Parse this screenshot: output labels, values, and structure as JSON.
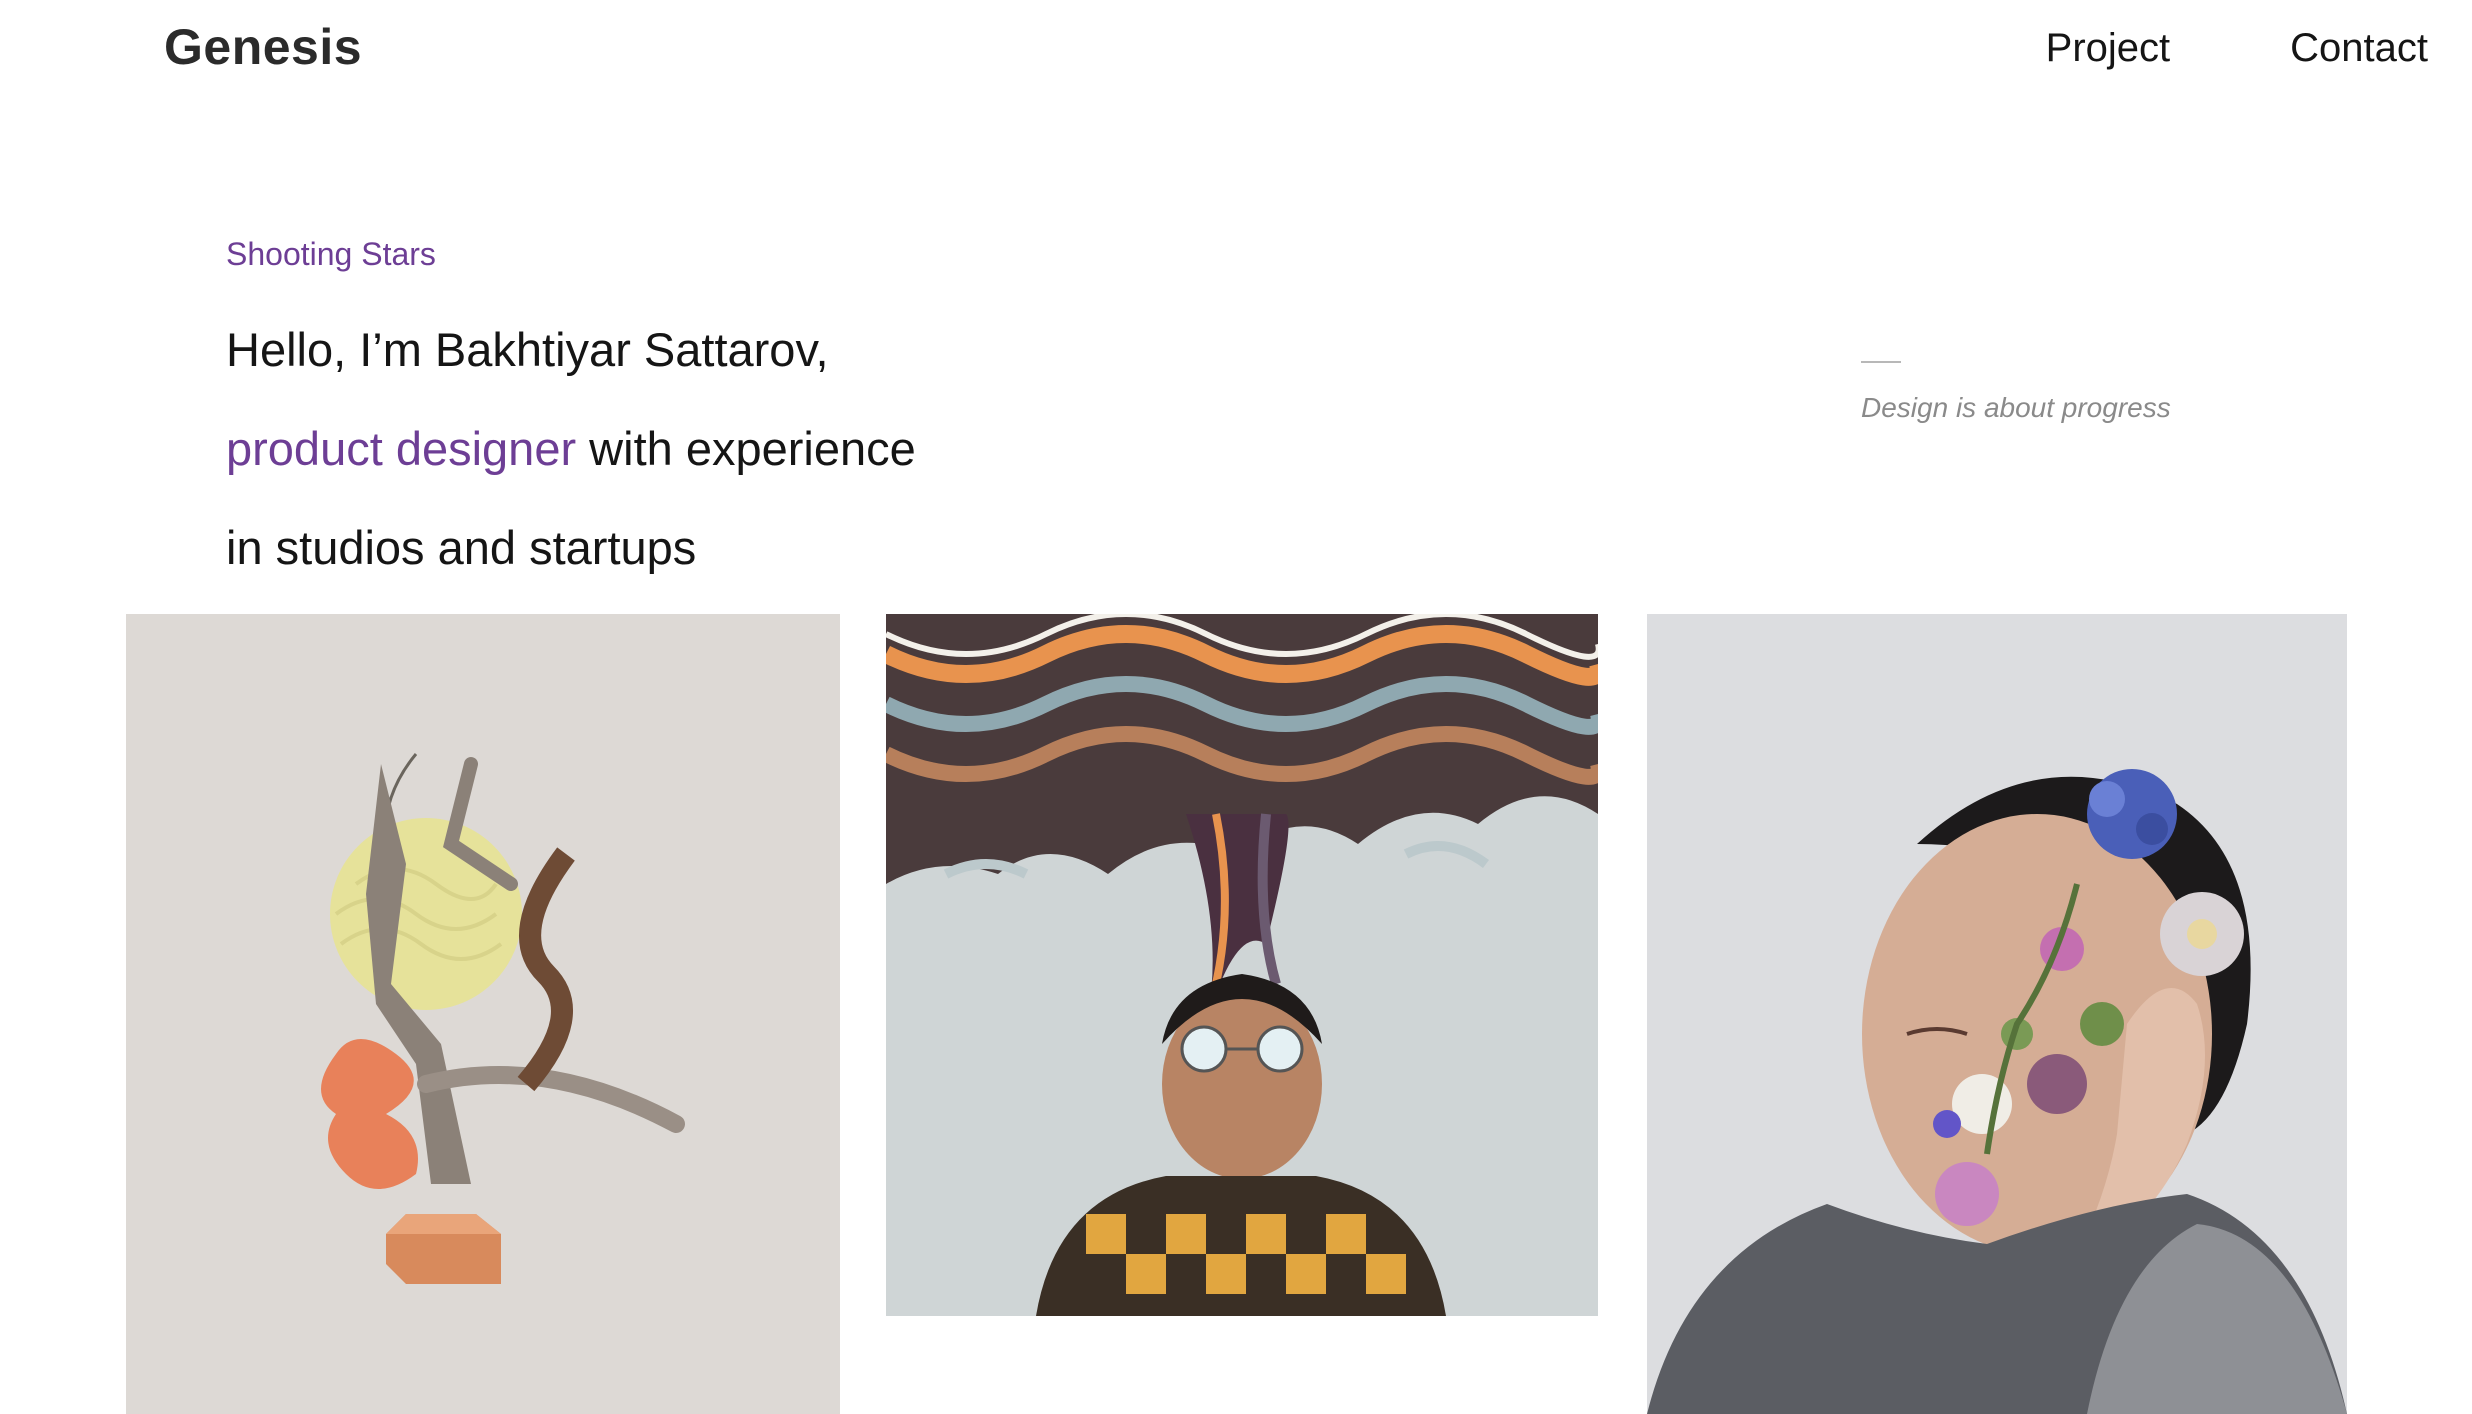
{
  "header": {
    "logo": "Genesis",
    "nav": [
      "Project",
      "Contact"
    ]
  },
  "hero": {
    "eyebrow": "Shooting Stars",
    "line1": "Hello, I’m Bakhtiyar Sattarov,",
    "line2_accent": "product designer",
    "line2_rest": " with experience",
    "line3": "in studios and startups",
    "tagline": "Design is about progress"
  },
  "gallery": {
    "items": [
      {
        "icon": "collage-dancer-illustration"
      },
      {
        "icon": "man-with-wavy-hair-illustration"
      },
      {
        "icon": "floral-face-portrait"
      }
    ]
  },
  "colors": {
    "accent": "#6d3e95",
    "text": "#151515",
    "muted": "#8a8a8a",
    "background": "#ffffff"
  }
}
